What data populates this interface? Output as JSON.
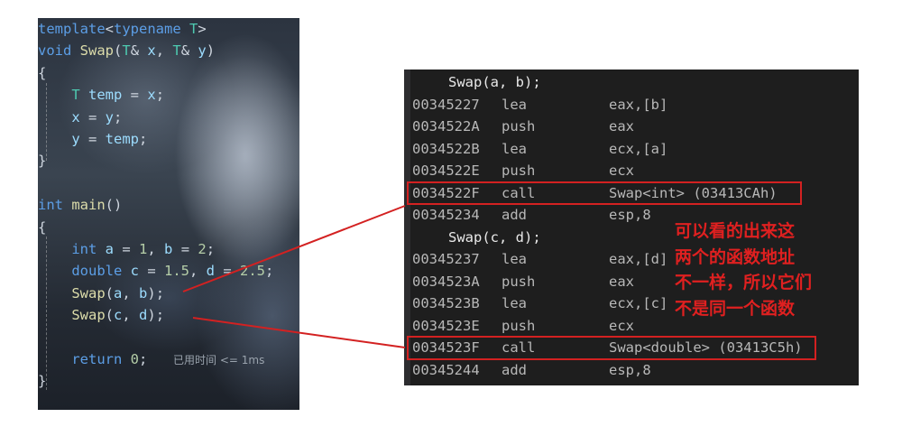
{
  "editor": {
    "lines": [
      [
        {
          "t": "template",
          "c": "kw"
        },
        {
          "t": "<",
          "c": "pn"
        },
        {
          "t": "typename",
          "c": "kw"
        },
        {
          "t": " T",
          "c": "ty"
        },
        {
          "t": ">",
          "c": "pn"
        }
      ],
      [
        {
          "t": "void",
          "c": "kw"
        },
        {
          "t": " Swap",
          "c": "fn"
        },
        {
          "t": "(",
          "c": "pn"
        },
        {
          "t": "T",
          "c": "ty"
        },
        {
          "t": "& ",
          "c": "pn"
        },
        {
          "t": "x",
          "c": "var"
        },
        {
          "t": ", ",
          "c": "pn"
        },
        {
          "t": "T",
          "c": "ty"
        },
        {
          "t": "& ",
          "c": "pn"
        },
        {
          "t": "y",
          "c": "var"
        },
        {
          "t": ")",
          "c": "pn"
        }
      ],
      [
        {
          "t": "{",
          "c": "pn"
        }
      ],
      [
        {
          "t": "    T",
          "c": "ty"
        },
        {
          "t": " temp",
          "c": "var"
        },
        {
          "t": " = ",
          "c": "pn"
        },
        {
          "t": "x",
          "c": "var"
        },
        {
          "t": ";",
          "c": "pn"
        }
      ],
      [
        {
          "t": "    x",
          "c": "var"
        },
        {
          "t": " = ",
          "c": "pn"
        },
        {
          "t": "y",
          "c": "var"
        },
        {
          "t": ";",
          "c": "pn"
        }
      ],
      [
        {
          "t": "    y",
          "c": "var"
        },
        {
          "t": " = ",
          "c": "pn"
        },
        {
          "t": "temp",
          "c": "var"
        },
        {
          "t": ";",
          "c": "pn"
        }
      ],
      [
        {
          "t": "}",
          "c": "pn"
        }
      ],
      [
        {
          "t": "",
          "c": "pn"
        }
      ],
      [
        {
          "t": "int",
          "c": "kw"
        },
        {
          "t": " main",
          "c": "fn"
        },
        {
          "t": "()",
          "c": "pn"
        }
      ],
      [
        {
          "t": "{",
          "c": "pn"
        }
      ],
      [
        {
          "t": "    int",
          "c": "kw"
        },
        {
          "t": " a",
          "c": "var"
        },
        {
          "t": " = ",
          "c": "pn"
        },
        {
          "t": "1",
          "c": "num"
        },
        {
          "t": ", ",
          "c": "pn"
        },
        {
          "t": "b",
          "c": "var"
        },
        {
          "t": " = ",
          "c": "pn"
        },
        {
          "t": "2",
          "c": "num"
        },
        {
          "t": ";",
          "c": "pn"
        }
      ],
      [
        {
          "t": "    double",
          "c": "kw"
        },
        {
          "t": " c",
          "c": "var"
        },
        {
          "t": " = ",
          "c": "pn"
        },
        {
          "t": "1.5",
          "c": "num"
        },
        {
          "t": ", ",
          "c": "pn"
        },
        {
          "t": "d",
          "c": "var"
        },
        {
          "t": " = ",
          "c": "pn"
        },
        {
          "t": "2.5",
          "c": "num"
        },
        {
          "t": ";",
          "c": "pn"
        }
      ],
      [
        {
          "t": "    Swap",
          "c": "fn"
        },
        {
          "t": "(",
          "c": "pn"
        },
        {
          "t": "a",
          "c": "var"
        },
        {
          "t": ", ",
          "c": "pn"
        },
        {
          "t": "b",
          "c": "var"
        },
        {
          "t": ");",
          "c": "pn"
        }
      ],
      [
        {
          "t": "    Swap",
          "c": "fn"
        },
        {
          "t": "(",
          "c": "pn"
        },
        {
          "t": "c",
          "c": "var"
        },
        {
          "t": ", ",
          "c": "pn"
        },
        {
          "t": "d",
          "c": "var"
        },
        {
          "t": ");",
          "c": "pn"
        }
      ],
      [
        {
          "t": "",
          "c": "pn"
        }
      ],
      [
        {
          "t": "    return",
          "c": "kw"
        },
        {
          "t": " 0",
          "c": "num"
        },
        {
          "t": ";",
          "c": "pn"
        }
      ],
      [
        {
          "t": "}",
          "c": "pn"
        }
      ]
    ],
    "elapsed_label": "已用时间 <= 1ms"
  },
  "disassembly": {
    "rows": [
      {
        "source": "Swap(a, b);"
      },
      {
        "addr": "00345227",
        "op": "lea",
        "arg": "eax,[b]"
      },
      {
        "addr": "0034522A",
        "op": "push",
        "arg": "eax"
      },
      {
        "addr": "0034522B",
        "op": "lea",
        "arg": "ecx,[a]"
      },
      {
        "addr": "0034522E",
        "op": "push",
        "arg": "ecx"
      },
      {
        "addr": "0034522F",
        "op": "call",
        "arg": "Swap<int> (03413CAh)",
        "highlight": true
      },
      {
        "addr": "00345234",
        "op": "add",
        "arg": "esp,8"
      },
      {
        "source": "Swap(c, d);"
      },
      {
        "addr": "00345237",
        "op": "lea",
        "arg": "eax,[d]"
      },
      {
        "addr": "0034523A",
        "op": "push",
        "arg": "eax"
      },
      {
        "addr": "0034523B",
        "op": "lea",
        "arg": "ecx,[c]"
      },
      {
        "addr": "0034523E",
        "op": "push",
        "arg": "ecx"
      },
      {
        "addr": "0034523F",
        "op": "call",
        "arg": "Swap<double> (03413C5h)",
        "highlight": true
      },
      {
        "addr": "00345244",
        "op": "add",
        "arg": "esp,8"
      }
    ]
  },
  "annotation": {
    "lines": [
      "可以看的出来这",
      "两个的函数地址",
      "不一样，所以它们",
      "不是同一个函数"
    ],
    "color": "#e02020"
  },
  "colors": {
    "highlight_border": "#d32121",
    "asm_background": "#1e1e1e",
    "keyword": "#5c9ee6",
    "function": "#dcdcaa",
    "type": "#4ec9b0",
    "variable": "#9cdcfe",
    "number": "#b5cea8"
  }
}
